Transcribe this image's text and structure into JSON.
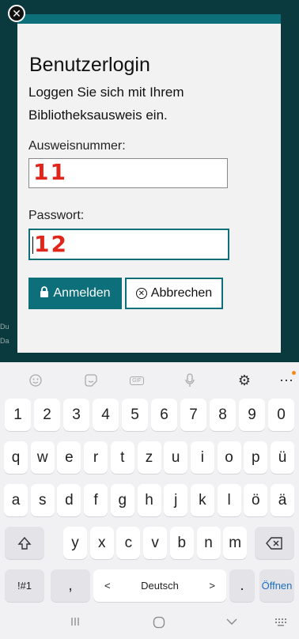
{
  "dialog": {
    "title": "Benutzerlogin",
    "subtitle": "Loggen Sie sich mit Ihrem Bibliotheksausweis ein.",
    "card_label": "Ausweisnummer:",
    "card_value": "11",
    "password_label": "Passwort:",
    "password_value": "12",
    "login_label": "Anmelden",
    "cancel_label": "Abbrechen",
    "close_glyph": "✕"
  },
  "background_text": [
    "Du",
    "Da"
  ],
  "keyboard": {
    "toolbar": [
      "emoji-icon",
      "sticker-icon",
      "gif-icon",
      "mic-icon",
      "settings-icon",
      "more-icon"
    ],
    "gif_label": "GIF",
    "row1": [
      "1",
      "2",
      "3",
      "4",
      "5",
      "6",
      "7",
      "8",
      "9",
      "0"
    ],
    "row2": [
      "q",
      "w",
      "e",
      "r",
      "t",
      "z",
      "u",
      "i",
      "o",
      "p",
      "ü"
    ],
    "row3": [
      "a",
      "s",
      "d",
      "f",
      "g",
      "h",
      "j",
      "k",
      "l",
      "ö",
      "ä"
    ],
    "row4": [
      "y",
      "x",
      "c",
      "v",
      "b",
      "n",
      "m"
    ],
    "symbols_label": "!#1",
    "comma_label": ",",
    "space_label": "Deutsch",
    "space_left": "<",
    "space_right": ">",
    "period_label": ".",
    "enter_label": "Öffnen",
    "accent_dot_color": "#f28a1b"
  },
  "colors": {
    "accent": "#0c6f7a",
    "marker": "#e0251b"
  }
}
